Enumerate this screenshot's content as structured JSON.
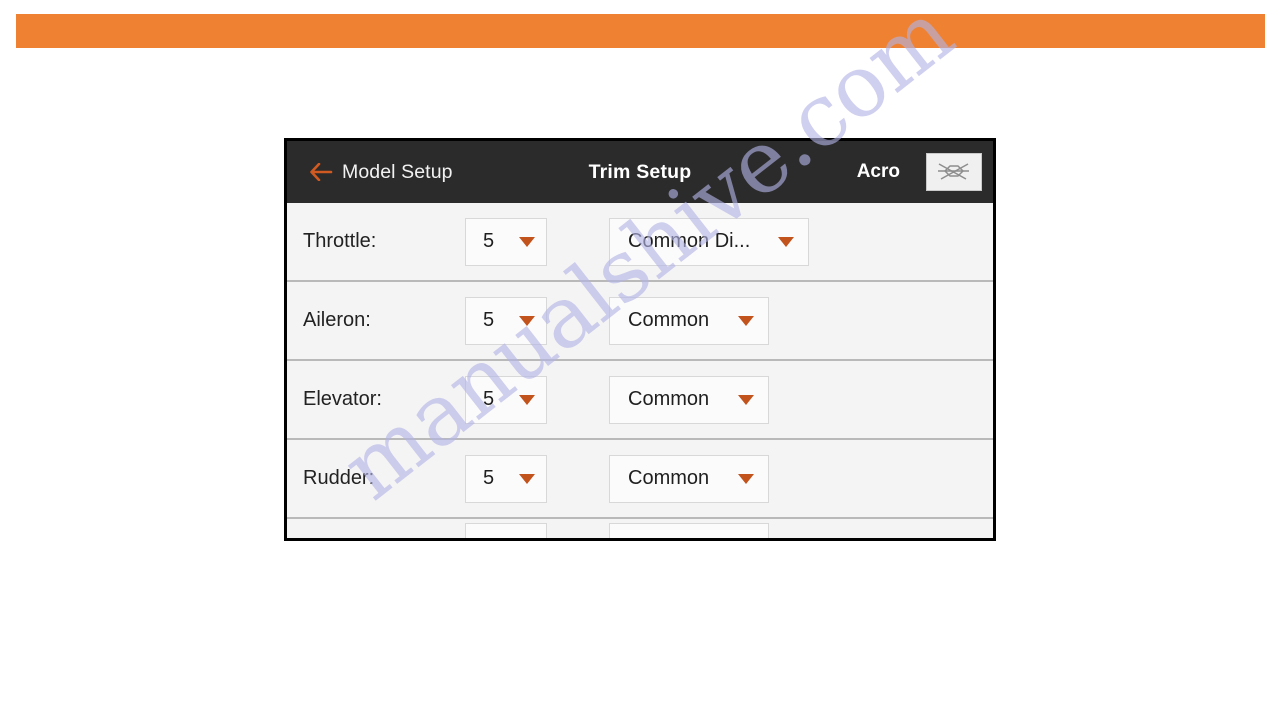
{
  "banner": {
    "color": "#ef8232"
  },
  "device": {
    "header": {
      "back_icon": "arrow-left-icon",
      "back_label": "Model Setup",
      "title": "Trim Setup",
      "model_name": "Acro",
      "model_type_icon": "airplane-icon",
      "background": "#2b2b2b",
      "accent": "#c2531c"
    },
    "rows": [
      {
        "label": "Throttle:",
        "step_value": "5",
        "mode_value": "Common Di...",
        "mode_width": "wide"
      },
      {
        "label": "Aileron:",
        "step_value": "5",
        "mode_value": "Common",
        "mode_width": "narrow"
      },
      {
        "label": "Elevator:",
        "step_value": "5",
        "mode_value": "Common",
        "mode_width": "narrow"
      },
      {
        "label": "Rudder:",
        "step_value": "5",
        "mode_value": "Common",
        "mode_width": "narrow"
      }
    ]
  },
  "watermark": {
    "text": "manualshive.com",
    "color": "#b3b3e6"
  }
}
